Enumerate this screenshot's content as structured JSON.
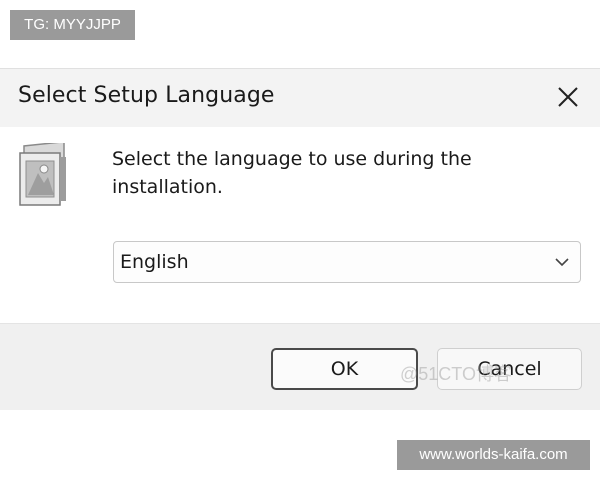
{
  "watermarks": {
    "top_left": "TG: MYYJJPP",
    "bottom_right": "www.worlds-kaifa.com",
    "overlay": "@51CTO博客"
  },
  "dialog": {
    "title": "Select Setup Language",
    "close_icon": "close-icon",
    "setup_icon": "setup-installer-icon",
    "prompt": "Select the language to use during the installation.",
    "language_select": {
      "selected": "English",
      "icon": "chevron-down-icon"
    },
    "buttons": {
      "ok": "OK",
      "cancel": "Cancel"
    }
  }
}
